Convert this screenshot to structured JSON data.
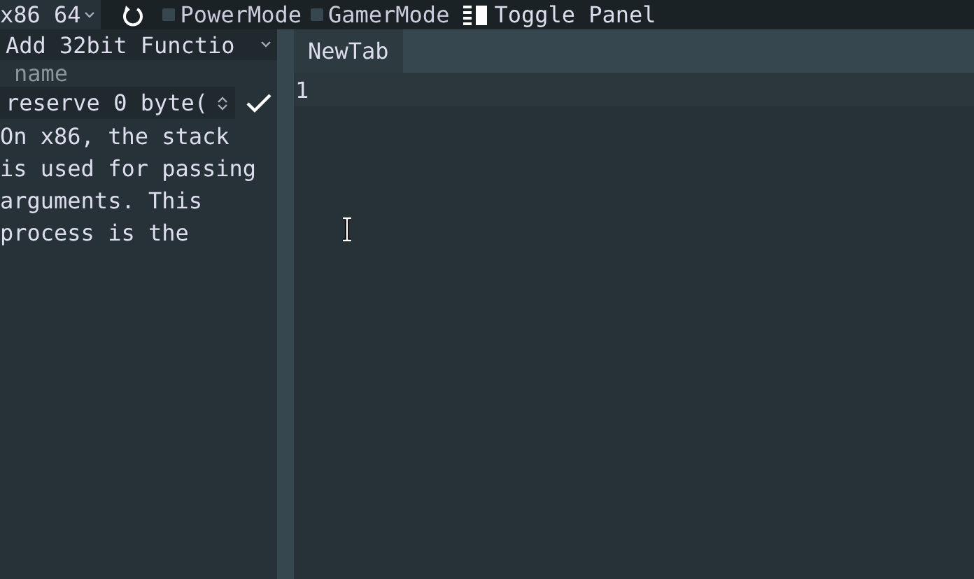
{
  "toolbar": {
    "arch_select": "x86 64",
    "power_mode": {
      "label": "PowerMode",
      "checked": false
    },
    "gamer_mode": {
      "label": "GamerMode",
      "checked": false
    },
    "toggle_panel": "Toggle Panel"
  },
  "sidebar": {
    "function_select": "Add 32bit Functio",
    "name_placeholder": "name",
    "reserve_select": "reserve 0 byte(",
    "description_lines": [
      "On x86, the stack",
      "is used for passing",
      "arguments. This",
      "process is the"
    ]
  },
  "editor": {
    "tabs": [
      {
        "label": "NewTab",
        "selected": true
      }
    ],
    "line_numbers": [
      "1"
    ]
  }
}
